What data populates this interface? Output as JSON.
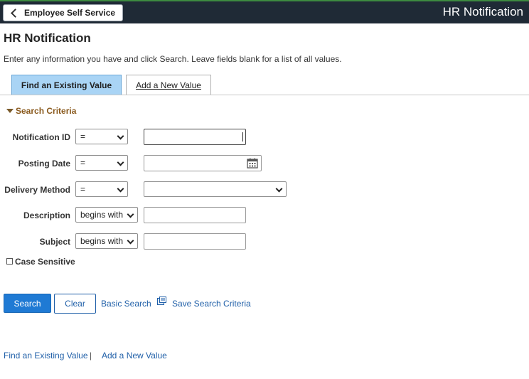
{
  "topbar": {
    "back_label": "Employee Self Service",
    "title": "HR Notification"
  },
  "page": {
    "title": "HR Notification",
    "instructions": "Enter any information you have and click Search. Leave fields blank for a list of all values."
  },
  "tabs": [
    {
      "label": "Find an Existing Value",
      "active": true
    },
    {
      "label": "Add a New Value",
      "active": false
    }
  ],
  "search_criteria": {
    "header": "Search Criteria",
    "fields": [
      {
        "label": "Notification ID",
        "operator": "=",
        "value": ""
      },
      {
        "label": "Posting Date",
        "operator": "=",
        "value": ""
      },
      {
        "label": "Delivery Method",
        "operator": "=",
        "value": ""
      },
      {
        "label": "Description",
        "operator": "begins with",
        "value": ""
      },
      {
        "label": "Subject",
        "operator": "begins with",
        "value": ""
      }
    ],
    "case_sensitive_label": "Case Sensitive",
    "case_sensitive_checked": false
  },
  "actions": {
    "search": "Search",
    "clear": "Clear",
    "basic_search": "Basic Search",
    "save_search_criteria": "Save Search Criteria"
  },
  "footer_links": {
    "find_existing": "Find an Existing Value",
    "separator": "|",
    "add_new": "Add a New Value"
  },
  "colors": {
    "topbar_bg": "#1f2a36",
    "primary_button": "#1f7ad4",
    "link": "#1f5fa8",
    "active_tab": "#a9d4f5",
    "section_header": "#8a5a1e"
  }
}
